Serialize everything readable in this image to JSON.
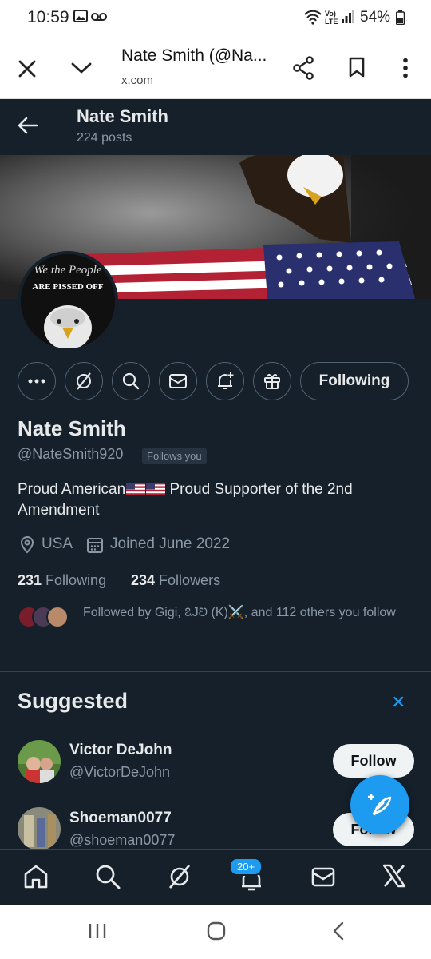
{
  "status_bar": {
    "time": "10:59",
    "battery": "54%"
  },
  "browser": {
    "title": "Nate Smith (@Na...",
    "url": "x.com"
  },
  "header": {
    "name": "Nate Smith",
    "posts": "224 posts"
  },
  "banner": {
    "avatar_text_top": "We the People",
    "avatar_text_bottom": "ARE PISSED OFF"
  },
  "profile": {
    "name": "Nate Smith",
    "handle": "@NateSmith920",
    "follows_you": "Follows you",
    "bio_part1": "Proud American",
    "bio_part2": " Proud Supporter of the 2nd Amendment",
    "location": "USA",
    "joined": "Joined June 2022",
    "following_count": "231",
    "following_label": " Following",
    "followers_count": "234",
    "followers_label": " Followers",
    "followed_by": "Followed by Gigi, ꢣJꢤ (K)⚔️, and 112 others you follow"
  },
  "actions": {
    "following_label": "Following"
  },
  "suggested": {
    "title": "Suggested",
    "close": "✕",
    "users": [
      {
        "name": "Victor DeJohn",
        "handle": "@VictorDeJohn",
        "button": "Follow"
      },
      {
        "name": "Shoeman0077",
        "handle": "@shoeman0077",
        "button": "Follow"
      }
    ]
  },
  "bottom_nav": {
    "notifications_badge": "20+"
  },
  "colors": {
    "background": "#15202b",
    "accent": "#1d9bf0",
    "muted": "#8b98a5"
  }
}
